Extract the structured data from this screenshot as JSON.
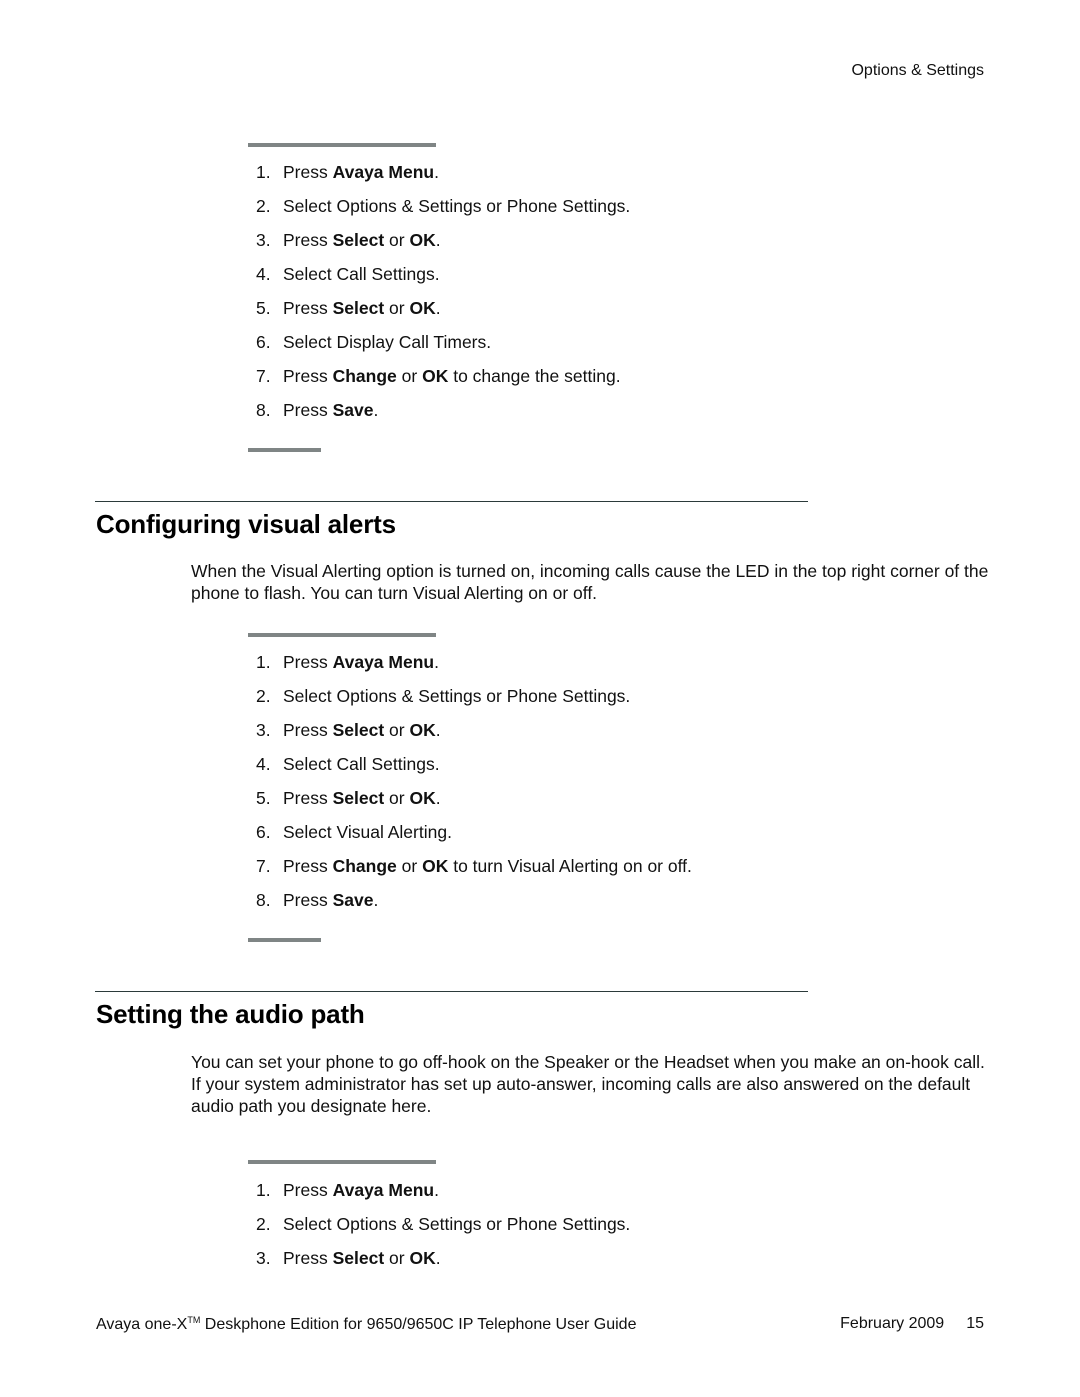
{
  "header": {
    "running_title": "Options & Settings"
  },
  "procedure_timers": {
    "steps": [
      {
        "num": "1.",
        "parts": [
          {
            "t": "Press "
          },
          {
            "t": "Avaya Menu",
            "b": true
          },
          {
            "t": "."
          }
        ]
      },
      {
        "num": "2.",
        "parts": [
          {
            "t": "Select Options & Settings or Phone Settings."
          }
        ]
      },
      {
        "num": "3.",
        "parts": [
          {
            "t": "Press "
          },
          {
            "t": "Select",
            "b": true
          },
          {
            "t": " or "
          },
          {
            "t": "OK",
            "b": true
          },
          {
            "t": "."
          }
        ]
      },
      {
        "num": "4.",
        "parts": [
          {
            "t": "Select Call Settings."
          }
        ]
      },
      {
        "num": "5.",
        "parts": [
          {
            "t": "Press "
          },
          {
            "t": "Select",
            "b": true
          },
          {
            "t": " or "
          },
          {
            "t": "OK",
            "b": true
          },
          {
            "t": "."
          }
        ]
      },
      {
        "num": "6.",
        "parts": [
          {
            "t": "Select Display Call Timers."
          }
        ]
      },
      {
        "num": "7.",
        "parts": [
          {
            "t": "Press "
          },
          {
            "t": "Change",
            "b": true
          },
          {
            "t": " or "
          },
          {
            "t": "OK",
            "b": true
          },
          {
            "t": " to change the setting."
          }
        ]
      },
      {
        "num": "8.",
        "parts": [
          {
            "t": "Press "
          },
          {
            "t": "Save",
            "b": true
          },
          {
            "t": "."
          }
        ]
      }
    ]
  },
  "section_visual_alerts": {
    "title": "Configuring visual alerts",
    "intro": "When the Visual Alerting option is turned on, incoming calls cause the LED in the top right corner of the phone to flash. You can turn Visual Alerting on or off.",
    "steps": [
      {
        "num": "1.",
        "parts": [
          {
            "t": "Press "
          },
          {
            "t": "Avaya Menu",
            "b": true
          },
          {
            "t": "."
          }
        ]
      },
      {
        "num": "2.",
        "parts": [
          {
            "t": "Select Options & Settings or Phone Settings."
          }
        ]
      },
      {
        "num": "3.",
        "parts": [
          {
            "t": "Press "
          },
          {
            "t": "Select",
            "b": true
          },
          {
            "t": " or "
          },
          {
            "t": "OK",
            "b": true
          },
          {
            "t": "."
          }
        ]
      },
      {
        "num": "4.",
        "parts": [
          {
            "t": "Select Call Settings."
          }
        ]
      },
      {
        "num": "5.",
        "parts": [
          {
            "t": "Press "
          },
          {
            "t": "Select",
            "b": true
          },
          {
            "t": " or "
          },
          {
            "t": "OK",
            "b": true
          },
          {
            "t": "."
          }
        ]
      },
      {
        "num": "6.",
        "parts": [
          {
            "t": "Select Visual Alerting."
          }
        ]
      },
      {
        "num": "7.",
        "parts": [
          {
            "t": "Press "
          },
          {
            "t": "Change",
            "b": true
          },
          {
            "t": " or "
          },
          {
            "t": "OK",
            "b": true
          },
          {
            "t": " to turn Visual Alerting on or off."
          }
        ]
      },
      {
        "num": "8.",
        "parts": [
          {
            "t": "Press "
          },
          {
            "t": "Save",
            "b": true
          },
          {
            "t": "."
          }
        ]
      }
    ]
  },
  "section_audio_path": {
    "title": "Setting the audio path",
    "intro": "You can set your phone to go off-hook on the Speaker or the Headset when you make an on-hook call. If your system administrator has set up auto-answer, incoming calls are also answered on the default audio path you designate here.",
    "steps": [
      {
        "num": "1.",
        "parts": [
          {
            "t": "Press "
          },
          {
            "t": "Avaya Menu",
            "b": true
          },
          {
            "t": "."
          }
        ]
      },
      {
        "num": "2.",
        "parts": [
          {
            "t": "Select Options & Settings or Phone Settings."
          }
        ]
      },
      {
        "num": "3.",
        "parts": [
          {
            "t": "Press "
          },
          {
            "t": "Select",
            "b": true
          },
          {
            "t": " or "
          },
          {
            "t": "OK",
            "b": true
          },
          {
            "t": "."
          }
        ]
      }
    ]
  },
  "footer": {
    "guide_prefix": "Avaya one-X",
    "trademark": "TM",
    "guide_suffix": " Deskphone Edition for 9650/9650C IP Telephone User Guide",
    "date": "February 2009",
    "page_number": "15"
  }
}
